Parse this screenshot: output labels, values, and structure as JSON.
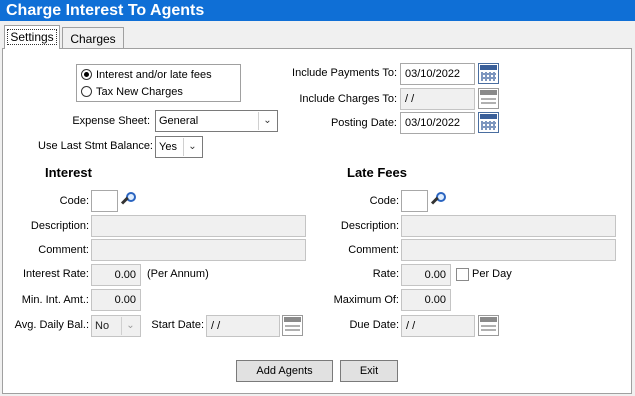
{
  "window": {
    "title": "Charge Interest To Agents"
  },
  "tabs": [
    {
      "label": "Settings"
    },
    {
      "label": "Charges"
    }
  ],
  "charge_type": {
    "options": [
      "Interest and/or late fees",
      "Tax New Charges"
    ],
    "selected": "Interest and/or late fees"
  },
  "expense_sheet": {
    "label": "Expense Sheet:",
    "value": "General"
  },
  "use_last_stmt_balance": {
    "label": "Use Last Stmt Balance:",
    "value": "Yes"
  },
  "include_payments_to": {
    "label": "Include Payments To:",
    "value": "03/10/2022"
  },
  "include_charges_to": {
    "label": "Include Charges To:",
    "value": "  /  /"
  },
  "posting_date": {
    "label": "Posting Date:",
    "value": "03/10/2022"
  },
  "interest": {
    "heading": "Interest",
    "code_label": "Code:",
    "code_value": "",
    "description_label": "Description:",
    "description_value": "",
    "comment_label": "Comment:",
    "comment_value": "",
    "rate_label": "Interest Rate:",
    "rate_value": "0.00",
    "rate_suffix": "(Per Annum)",
    "min_amt_label": "Min. Int. Amt.:",
    "min_amt_value": "0.00",
    "avg_daily_label": "Avg. Daily Bal.:",
    "avg_daily_value": "No",
    "start_date_label": "Start Date:",
    "start_date_value": "  /  /"
  },
  "late_fees": {
    "heading": "Late Fees",
    "code_label": "Code:",
    "code_value": "",
    "description_label": "Description:",
    "description_value": "",
    "comment_label": "Comment:",
    "comment_value": "",
    "rate_label": "Rate:",
    "rate_value": "0.00",
    "per_day_label": "Per Day",
    "per_day_checked": false,
    "maximum_label": "Maximum Of:",
    "maximum_value": "0.00",
    "due_date_label": "Due Date:",
    "due_date_value": "  /  /"
  },
  "buttons": {
    "add_agents": "Add Agents",
    "exit": "Exit"
  },
  "icons": {
    "calendar": "calendar-icon",
    "lookup": "magnifier-icon"
  },
  "colors": {
    "titlebar": "#0f6fd6"
  }
}
